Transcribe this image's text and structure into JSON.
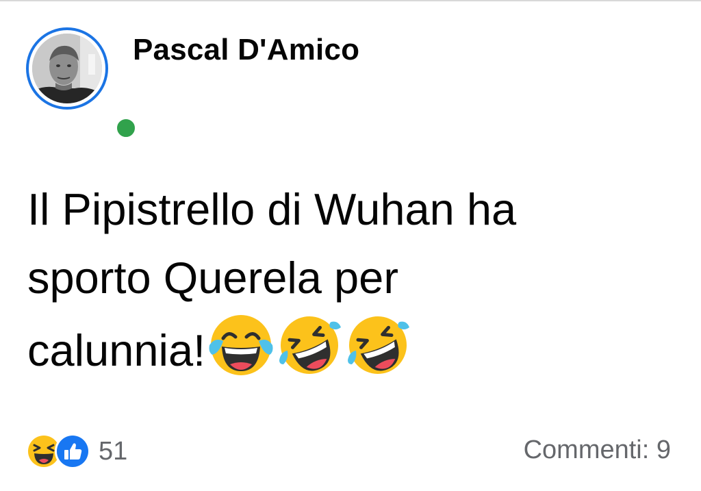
{
  "post": {
    "author_name": "Pascal D'Amico",
    "author_online": true,
    "text_lines": [
      "Il Pipistrello di Wuhan ha",
      "sporto Querela per",
      "calunnia!"
    ],
    "trailing_emojis": [
      "face-with-tears-of-joy-icon",
      "rolling-on-floor-laughing-icon",
      "rolling-on-floor-laughing-icon"
    ]
  },
  "footer": {
    "reaction_icons": [
      "haha-reaction-icon",
      "like-reaction-icon"
    ],
    "reaction_count": "51",
    "comments_label": "Commenti: 9"
  },
  "colors": {
    "avatar_ring": "#1b74e4",
    "online_dot": "#31a24c",
    "like_blue": "#1877f2",
    "secondary_text": "#65676b"
  }
}
